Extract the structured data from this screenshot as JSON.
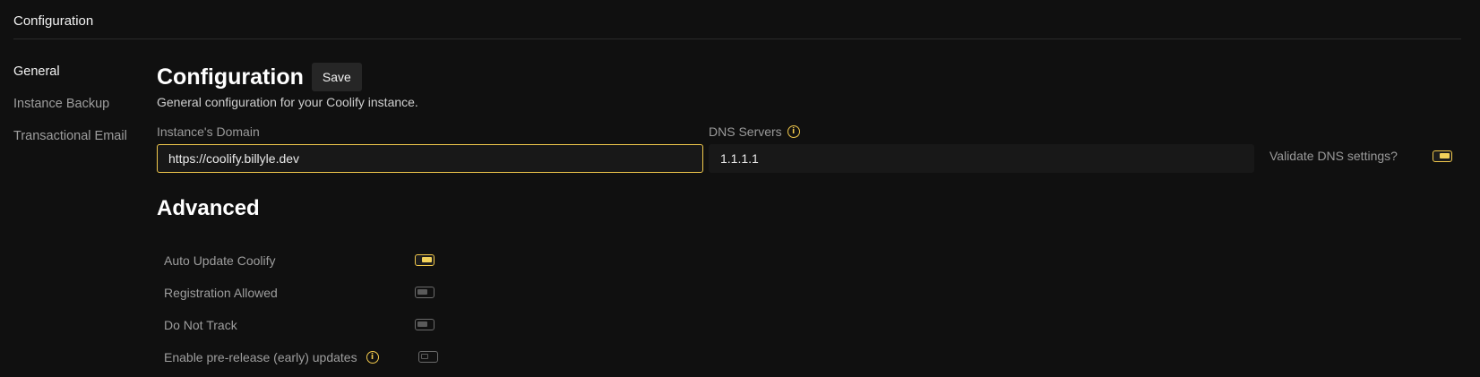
{
  "header": {
    "title": "Configuration"
  },
  "subnav": {
    "items": [
      {
        "label": "General",
        "active": true
      },
      {
        "label": "Instance Backup",
        "active": false
      },
      {
        "label": "Transactional Email",
        "active": false
      }
    ]
  },
  "main": {
    "title": "Configuration",
    "save_label": "Save",
    "subtitle": "General configuration for your Coolify instance."
  },
  "fields": {
    "domain": {
      "label": "Instance's Domain",
      "value": "https://coolify.billyle.dev"
    },
    "dns": {
      "label": "DNS Servers",
      "value": "1.1.1.1"
    },
    "validate_dns": {
      "label": "Validate DNS settings?",
      "enabled": true
    }
  },
  "advanced": {
    "title": "Advanced",
    "settings": [
      {
        "label": "Auto Update Coolify",
        "enabled": true
      },
      {
        "label": "Registration Allowed",
        "enabled": false
      },
      {
        "label": "Do Not Track",
        "enabled": false
      },
      {
        "label": "Enable pre-release (early) updates",
        "enabled": false
      }
    ]
  },
  "colors": {
    "accent": "#f2c94c",
    "background": "#101010",
    "input_bg": "#181818"
  },
  "icons": {
    "info": "info-circle-icon"
  }
}
